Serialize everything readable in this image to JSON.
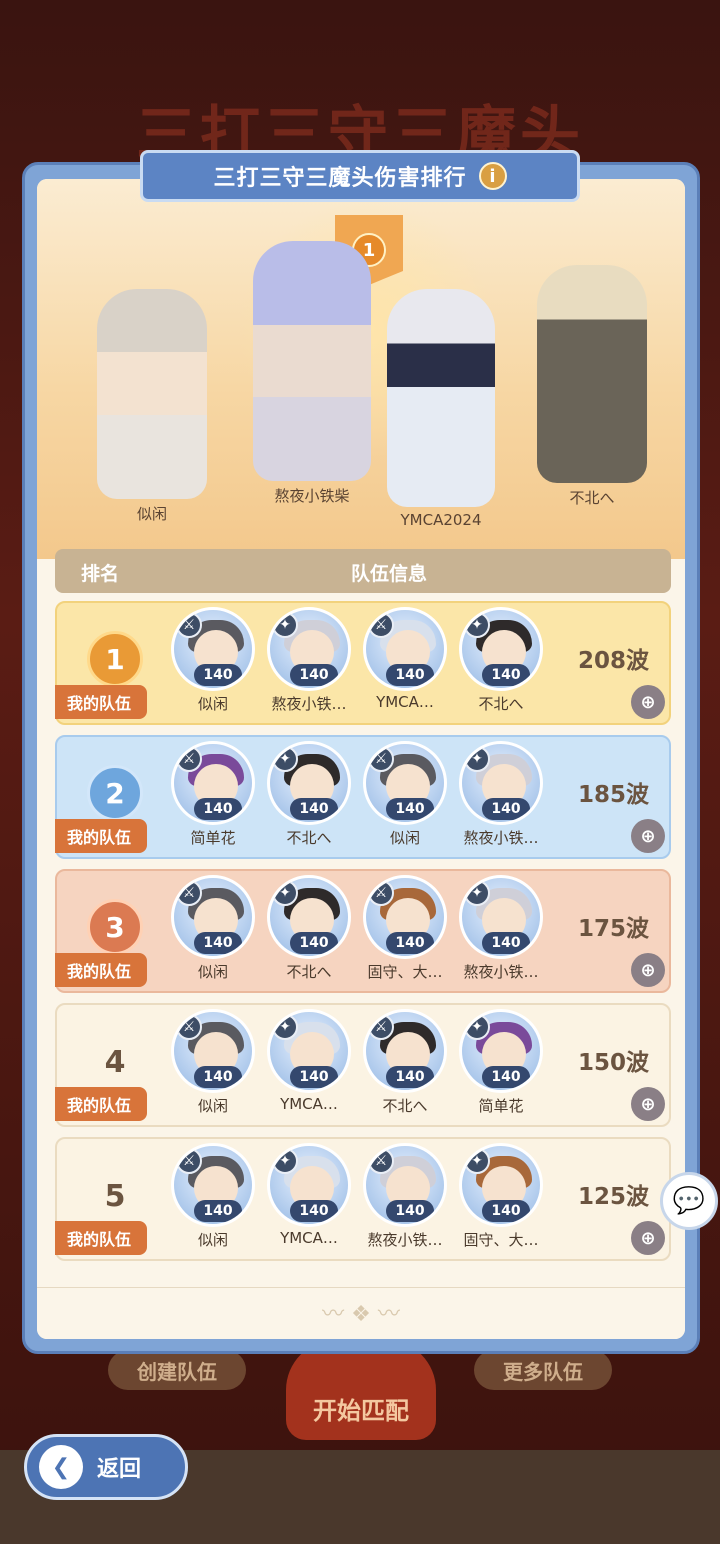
{
  "background": {
    "title": "三打三守三魔头",
    "create_team": "创建队伍",
    "start_match": "开始匹配",
    "more_teams": "更多队伍"
  },
  "header": {
    "title": "三打三守三魔头伤害排行",
    "info_icon": "i"
  },
  "podium": {
    "banner_rank": "1",
    "heroes": [
      {
        "name": "似闲",
        "hair": "#d9d2c8"
      },
      {
        "name": "熬夜小铁柴",
        "hair": "#b9bde8"
      },
      {
        "name": "YMCA2024",
        "hair": "#e8e8ee"
      },
      {
        "name": "不北へ",
        "hair": "#e8dcc0"
      }
    ]
  },
  "table": {
    "col_rank": "排名",
    "col_team": "队伍信息"
  },
  "rows": [
    {
      "rank": "1",
      "my_team": "我的队伍",
      "waves": "208波",
      "members": [
        {
          "name": "似闲",
          "level": "140",
          "hair": "#5a5a60"
        },
        {
          "name": "熬夜小铁…",
          "level": "140",
          "hair": "#cfcfd8"
        },
        {
          "name": "YMCA…",
          "level": "140",
          "hair": "#d8e0ec"
        },
        {
          "name": "不北へ",
          "level": "140",
          "hair": "#2e2a2a"
        }
      ]
    },
    {
      "rank": "2",
      "my_team": "我的队伍",
      "waves": "185波",
      "members": [
        {
          "name": "简单花",
          "level": "140",
          "hair": "#7a4a9a"
        },
        {
          "name": "不北へ",
          "level": "140",
          "hair": "#2e2a2a"
        },
        {
          "name": "似闲",
          "level": "140",
          "hair": "#5a5a60"
        },
        {
          "name": "熬夜小铁…",
          "level": "140",
          "hair": "#cfcfd8"
        }
      ]
    },
    {
      "rank": "3",
      "my_team": "我的队伍",
      "waves": "175波",
      "members": [
        {
          "name": "似闲",
          "level": "140",
          "hair": "#5a5a60"
        },
        {
          "name": "不北へ",
          "level": "140",
          "hair": "#2e2a2a"
        },
        {
          "name": "固守、大…",
          "level": "140",
          "hair": "#a8683a"
        },
        {
          "name": "熬夜小铁…",
          "level": "140",
          "hair": "#cfcfd8"
        }
      ]
    },
    {
      "rank": "4",
      "my_team": "我的队伍",
      "waves": "150波",
      "members": [
        {
          "name": "似闲",
          "level": "140",
          "hair": "#5a5a60"
        },
        {
          "name": "YMCA…",
          "level": "140",
          "hair": "#d8e0ec"
        },
        {
          "name": "不北へ",
          "level": "140",
          "hair": "#2e2a2a"
        },
        {
          "name": "简单花",
          "level": "140",
          "hair": "#7a4a9a"
        }
      ]
    },
    {
      "rank": "5",
      "my_team": "我的队伍",
      "waves": "125波",
      "members": [
        {
          "name": "似闲",
          "level": "140",
          "hair": "#5a5a60"
        },
        {
          "name": "YMCA…",
          "level": "140",
          "hair": "#d8e0ec"
        },
        {
          "name": "熬夜小铁…",
          "level": "140",
          "hair": "#cfcfd8"
        },
        {
          "name": "固守、大…",
          "level": "140",
          "hair": "#a8683a"
        }
      ]
    }
  ],
  "back": {
    "label": "返回"
  }
}
